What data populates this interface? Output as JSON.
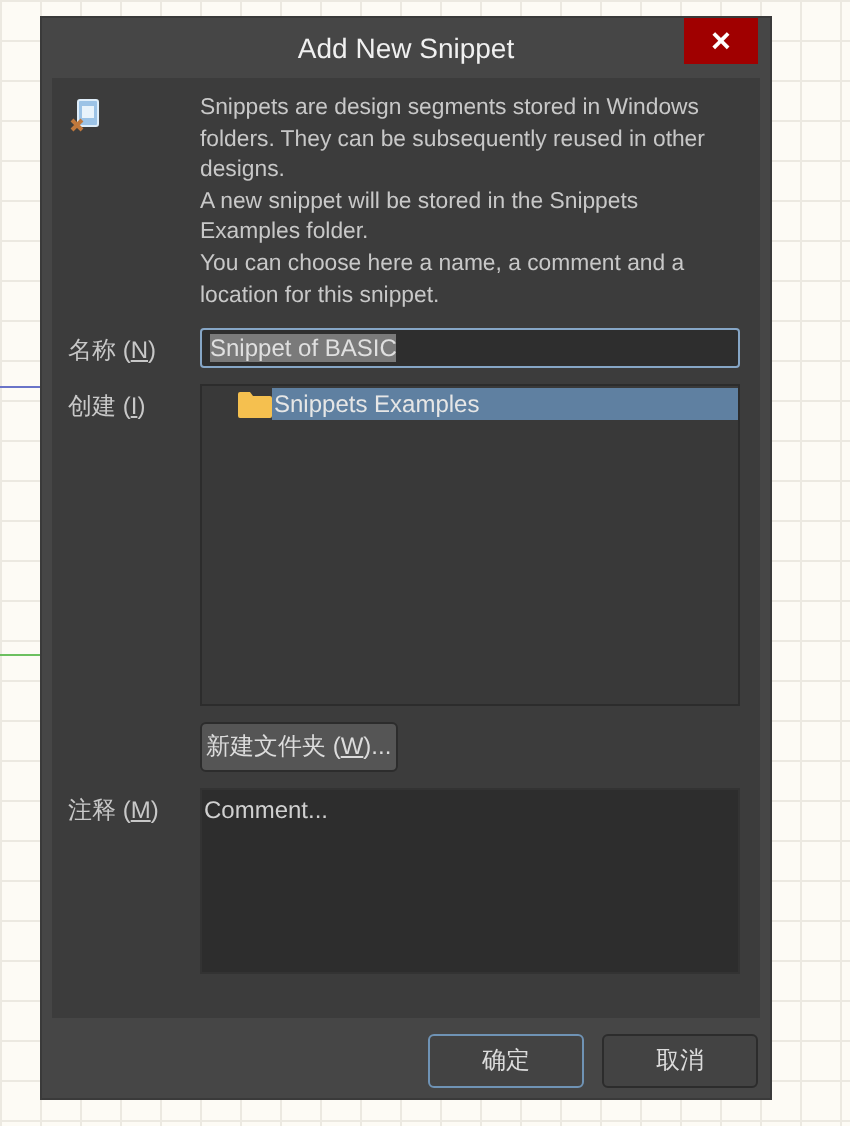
{
  "window": {
    "title": "Add New Snippet",
    "close": "×"
  },
  "description": [
    "Snippets are design segments stored in Windows folders. They can be subsequently reused in other designs.",
    "A new snippet will be stored in the Snippets Examples folder.",
    "You can choose here a name, a comment and a location for this snippet."
  ],
  "name_field": {
    "label": "名称 (",
    "access_key": "N",
    "label_end": ")",
    "value": "Snippet of BASIC",
    "text_selected": true
  },
  "location": {
    "label": "创建 (",
    "access_key": "I",
    "label_end": ")",
    "tree": [
      {
        "label": "Snippets Examples",
        "selected": true
      }
    ]
  },
  "new_folder_button": {
    "label": "新建文件夹 (",
    "access_key": "W",
    "label_end": ")..."
  },
  "comment_field": {
    "label": "注释 (",
    "access_key": "M",
    "label_end": ")",
    "placeholder": "Comment..."
  },
  "buttons": [
    {
      "label": "确定",
      "default": true
    },
    {
      "label": "取消",
      "default": false
    }
  ]
}
